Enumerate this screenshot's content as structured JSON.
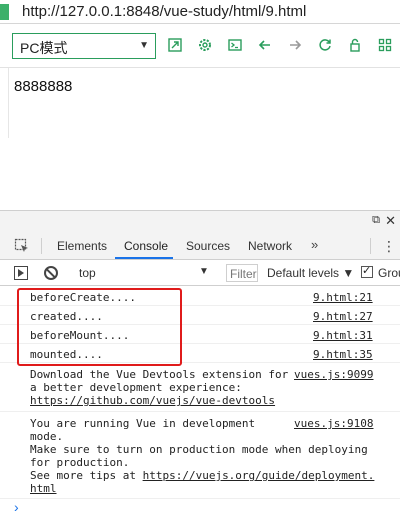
{
  "address_bar": {
    "url": "http://127.0.0.1:8848/vue-study/html/9.html"
  },
  "toolbar": {
    "mode_value": "PC模式",
    "icons": [
      "external-link-icon",
      "settings-icon",
      "terminal-icon",
      "back-arrow-icon",
      "forward-arrow-icon",
      "refresh-icon",
      "lock-icon",
      "grid-icon"
    ],
    "accent_color": "#2a9d5c"
  },
  "page": {
    "content_text": "8888888"
  },
  "devtools": {
    "tabs": [
      {
        "label": "Elements"
      },
      {
        "label": "Console"
      },
      {
        "label": "Sources"
      },
      {
        "label": "Network"
      }
    ],
    "more_tabs": "»",
    "filter_bar": {
      "context": "top",
      "filter_placeholder": "Filter",
      "levels": "Default levels",
      "group_label": "Grou"
    },
    "logs": [
      {
        "message": "beforeCreate....",
        "source": "9.html:21"
      },
      {
        "message": "created....",
        "source": "9.html:27"
      },
      {
        "message": "beforeMount....",
        "source": "9.html:31"
      },
      {
        "message": "mounted....",
        "source": "9.html:35"
      }
    ],
    "info_block_1": {
      "line1": "Download the Vue Devtools extension for",
      "line2": "a better development experience:",
      "link": "https://github.com/vuejs/vue-devtools",
      "source": "vues.js:9099"
    },
    "info_block_2": {
      "line1": "You are running Vue in development",
      "line2": "mode.",
      "line3": "Make sure to turn on production mode when deploying",
      "line4": "for production.",
      "line5_prefix": "See more tips at ",
      "line5_link": "https://vuejs.org/guide/deployment.",
      "line6_link": "html",
      "source": "vues.js:9108"
    },
    "prompt_symbol": "›",
    "highlight_color": "#e01b1b",
    "active_tab_color": "#1a73e8"
  }
}
